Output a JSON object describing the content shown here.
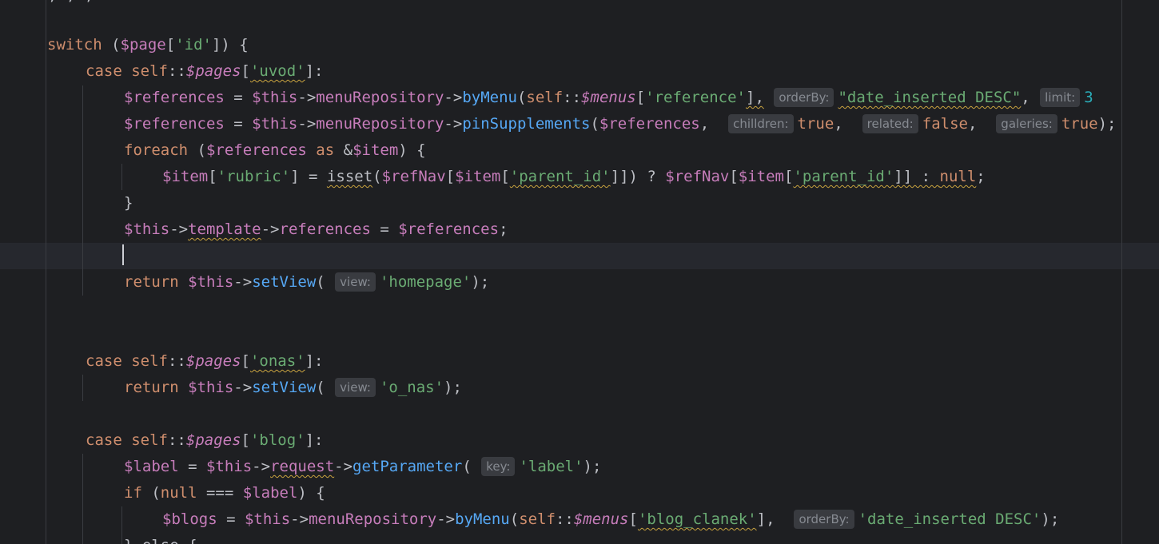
{
  "editor": {
    "top_fragment": ", , ;",
    "lines": {
      "switch": {
        "kw": "switch",
        "open": " (",
        "var": "$page",
        "b1": "[",
        "str": "'id'",
        "b2": "]) {"
      },
      "case_uvod": {
        "kw": "case",
        "self": "self",
        "colons": "::",
        "var": "$pages",
        "b1": "[",
        "str": "'uvod'",
        "b2": "]:"
      },
      "refs1": {
        "var": "$references",
        "eq": " = ",
        "this": "$this",
        "arrow1": "->",
        "prop": "menuRepository",
        "arrow2": "->",
        "method": "byMenu",
        "p1": "(",
        "self": "self",
        "colons": "::",
        "menus": "$menus",
        "b1": "[",
        "str": "'reference'",
        "b2": "],",
        "hint1": "orderBy:",
        "str2": "\"date_inserted DESC\"",
        "comma": ",",
        "hint2": "limit:",
        "num": "3"
      },
      "refs2": {
        "var": "$references",
        "eq": " = ",
        "this": "$this",
        "arrow1": "->",
        "prop": "menuRepository",
        "arrow2": "->",
        "method": "pinSupplements",
        "p1": "(",
        "arg": "$references",
        "c1": ",",
        "hint1": "chilldren:",
        "v1": "true",
        "c2": ",",
        "hint2": "related:",
        "v2": "false",
        "c3": ",",
        "hint3": "galeries:",
        "v3": "true",
        "end": ");"
      },
      "foreach": {
        "kw": "foreach",
        "open": " (",
        "var": "$references",
        "as": "as",
        "amp": "&",
        "item": "$item",
        "close": ") {"
      },
      "rubric": {
        "item": "$item",
        "b1": "[",
        "str": "'rubric'",
        "b2": "] = ",
        "isset": "isset",
        "p1": "(",
        "refnav": "$refNav",
        "b3": "[",
        "item2": "$item",
        "b4": "[",
        "str2": "'parent_id'",
        "b5": "]]) ? ",
        "refnav2": "$refNav",
        "b6": "[",
        "item3": "$item",
        "b7": "[",
        "str3": "'parent_id'",
        "b8": "]] : ",
        "null": "null",
        "semi": ";"
      },
      "close_brace": {
        "text": "}"
      },
      "template": {
        "this": "$this",
        "arrow1": "->",
        "prop": "template",
        "arrow2": "->",
        "prop2": "references",
        "eq": " = ",
        "var": "$references",
        "semi": ";"
      },
      "return_home": {
        "kw": "return",
        "this": "$this",
        "arrow": "->",
        "method": "setView",
        "p1": "(",
        "hint": "view:",
        "str": "'homepage'",
        "end": ");"
      },
      "case_onas": {
        "kw": "case",
        "self": "self",
        "colons": "::",
        "var": "$pages",
        "b1": "[",
        "str": "'onas'",
        "b2": "]:"
      },
      "return_onas": {
        "kw": "return",
        "this": "$this",
        "arrow": "->",
        "method": "setView",
        "p1": "(",
        "hint": "view:",
        "str": "'o_nas'",
        "end": ");"
      },
      "case_blog": {
        "kw": "case",
        "self": "self",
        "colons": "::",
        "var": "$pages",
        "b1": "[",
        "str": "'blog'",
        "b2": "]:"
      },
      "label": {
        "var": "$label",
        "eq": " = ",
        "this": "$this",
        "arrow1": "->",
        "prop": "request",
        "arrow2": "->",
        "method": "getParameter",
        "p1": "(",
        "hint": "key:",
        "str": "'label'",
        "end": ");"
      },
      "if_null": {
        "kw": "if",
        "open": " (",
        "null": "null",
        "op": " === ",
        "var": "$label",
        "close": ") {"
      },
      "blogs": {
        "var": "$blogs",
        "eq": " = ",
        "this": "$this",
        "arrow1": "->",
        "prop": "menuRepository",
        "arrow2": "->",
        "method": "byMenu",
        "p1": "(",
        "self": "self",
        "colons": "::",
        "menus": "$menus",
        "b1": "[",
        "str": "'blog_clanek'",
        "b2": "],",
        "hint": "orderBy:",
        "str2": "'date_inserted DESC'",
        "end": ");"
      },
      "else_frag": {
        "text": "} else {"
      }
    }
  },
  "colors": {
    "background": "#1e1f22",
    "keyword": "#cf8e6d",
    "variable": "#c77dbb",
    "string": "#6aab73",
    "function": "#56a8f5",
    "number": "#2aacb8",
    "default": "#bcbec4",
    "hint_bg": "#393b40",
    "hint_fg": "#868a91"
  }
}
